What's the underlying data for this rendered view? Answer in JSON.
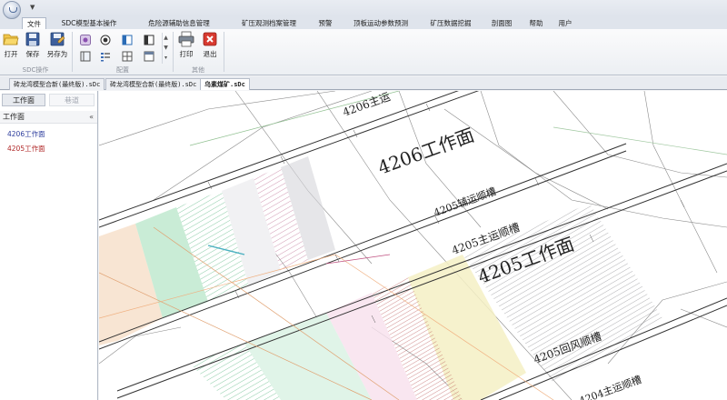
{
  "ribbon_tabs": [
    "文件",
    "SDC模型基本操作",
    "危险源辅助信息管理",
    "矿压观测档案管理",
    "预警",
    "顶板运动参数预测",
    "矿压数据挖掘",
    "剖面图",
    "帮助",
    "用户"
  ],
  "ribbon": {
    "open_label": "打开",
    "save_label": "保存",
    "save_as_label": "另存为",
    "print_label": "打印",
    "exit_label": "退出",
    "group_sdc": "SDC操作",
    "group_config": "配置",
    "group_other": "其他"
  },
  "doc_tabs": [
    "砖龙湾模型合新(最终版).sDc",
    "砖龙湾模型合新(最终版).sDc",
    "乌素煤矿.sDc"
  ],
  "left_panel": {
    "tab_workface": "工作面",
    "tab_other": "巷道",
    "header": "工作面",
    "collapse": "«",
    "items": [
      "4206工作面",
      "4205工作面"
    ]
  },
  "map_labels": {
    "main_road_top": "4206主运",
    "face_4206": "4206工作面",
    "aux_road": "4205辅运顺槽",
    "main_road_4205": "4205主运顺槽",
    "face_4205": "4205工作面",
    "return_road": "4205回风顺槽",
    "main_road_4204": "4204主运顺槽"
  },
  "colors": {
    "accent_blue": "#2c3c9c",
    "accent_red": "#b02828",
    "zone_green": "#9fe0b8",
    "zone_pink": "#e8b4cc",
    "zone_yellow": "#f5f0c4",
    "zone_orange": "#f4d0b0",
    "zone_gray": "#d0d0d4"
  }
}
